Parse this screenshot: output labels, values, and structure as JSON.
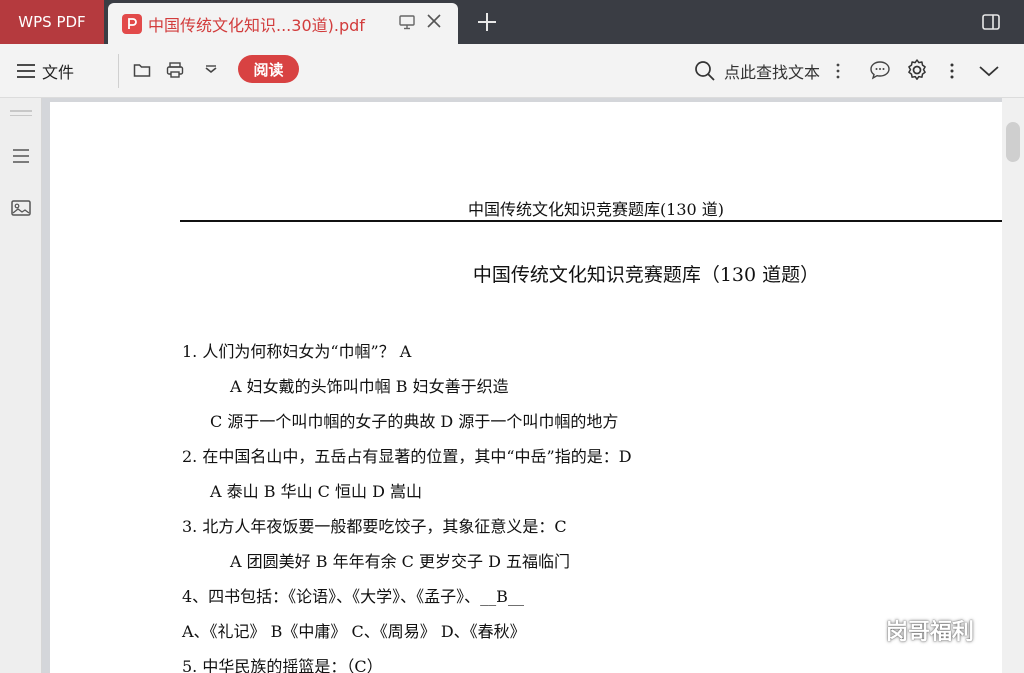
{
  "tabs": {
    "app_label": "WPS PDF",
    "doc_title": "中国传统文化知识...30道).pdf"
  },
  "toolbar": {
    "menu_label": "文件",
    "read_label": "阅读",
    "search_label": "点此查找文本"
  },
  "document": {
    "header": "中国传统文化知识竞赛题库(130 道)",
    "title": "中国传统文化知识竞赛题库（130 道题）",
    "lines": [
      "1. 人们为何称妇女为“巾帼”？ A",
      "A 妇女戴的头饰叫巾帼        B 妇女善于织造",
      "C 源于一个叫巾帼的女子的典故        D 源于一个叫巾帼的地方",
      "2. 在中国名山中，五岳占有显著的位置，其中“中岳”指的是：D",
      "A 泰山        B 华山        C 恒山        D 嵩山",
      "3. 北方人年夜饭要一般都要吃饺子，其象征意义是：C",
      "A 团圆美好        B 年年有余        C 更岁交子        D 五福临门",
      "4、四书包括：《论语》、《大学》、《孟子》、__B__",
      "A、《礼记》    B《中庸》    C、《周易》        D、《春秋》",
      "5. 中华民族的摇篮是：（C）"
    ]
  },
  "watermark": "岗哥福利",
  "colors": {
    "tab_bar": "#3a3d44",
    "app_tab": "#b53a3e",
    "accent": "#d84242"
  }
}
